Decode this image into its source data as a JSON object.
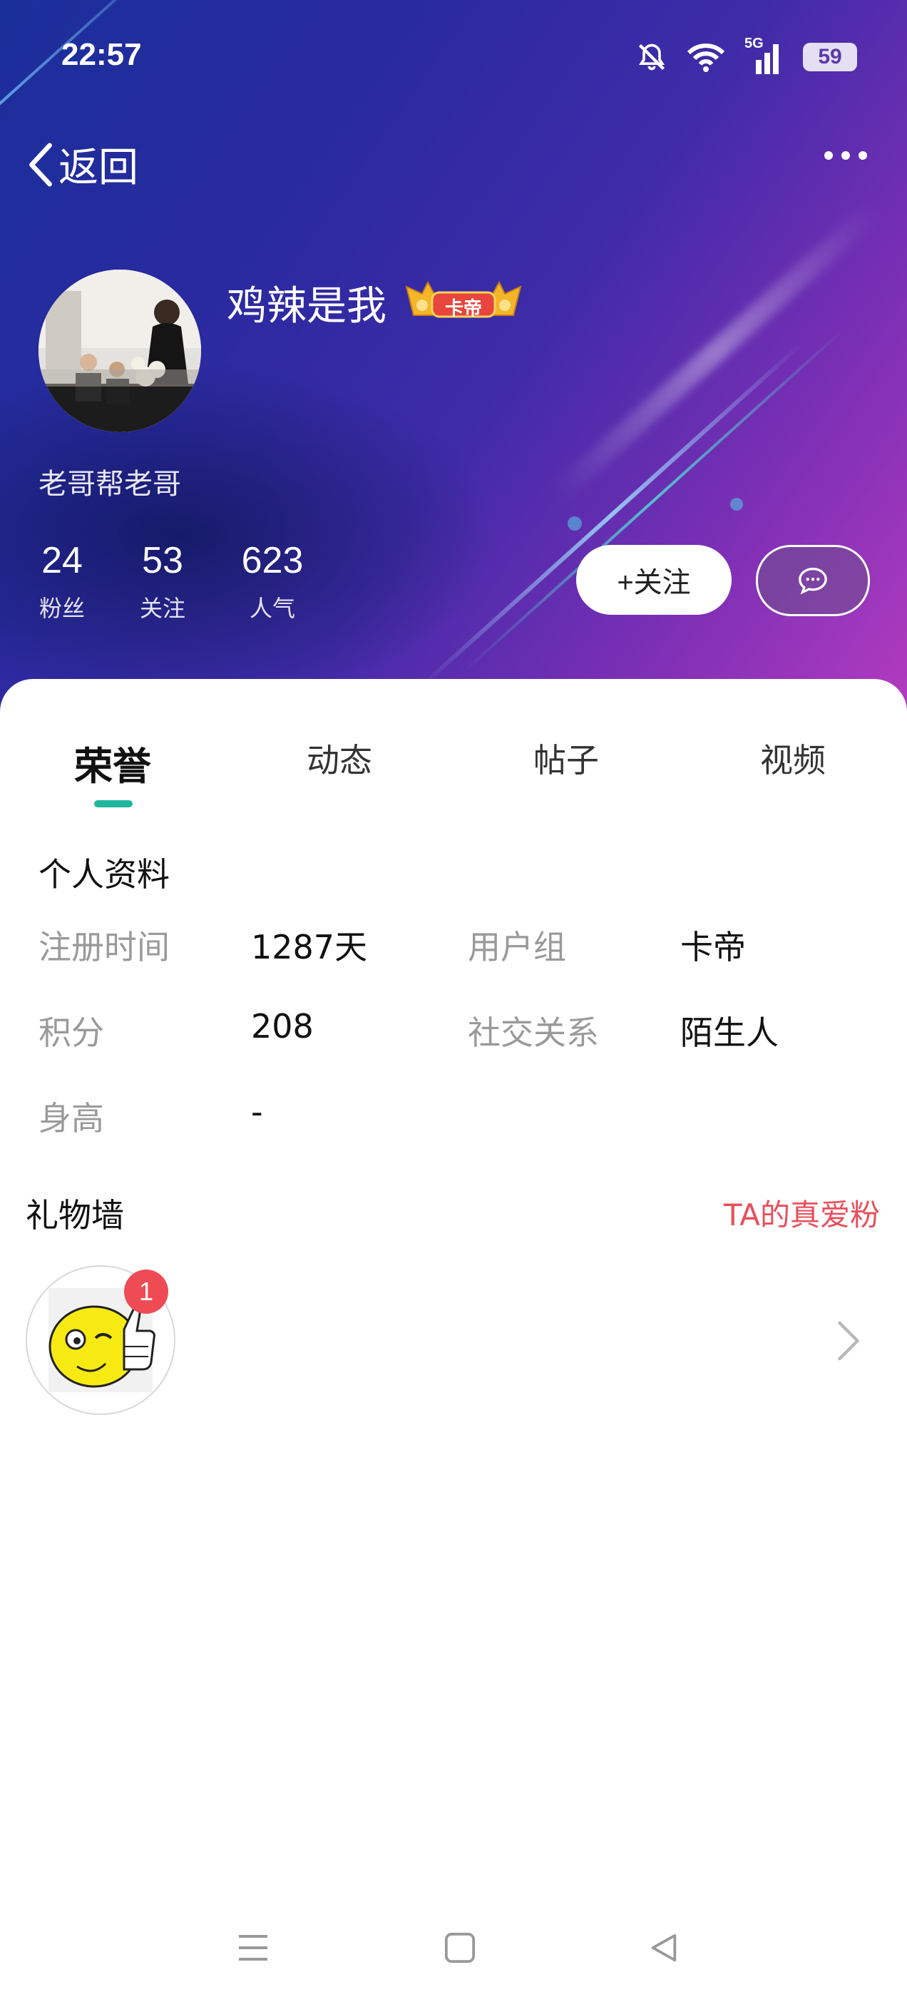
{
  "status_bar": {
    "time": "22:57",
    "network": "5G",
    "battery": "59"
  },
  "nav": {
    "back_label": "返回"
  },
  "profile": {
    "name": "鸡辣是我",
    "badge_text": "卡帝",
    "motto": "老哥帮老哥",
    "stats": [
      {
        "value": "24",
        "label": "粉丝"
      },
      {
        "value": "53",
        "label": "关注"
      },
      {
        "value": "623",
        "label": "人气"
      }
    ],
    "follow_label": "+关注"
  },
  "tabs": [
    {
      "label": "荣誉",
      "active": true
    },
    {
      "label": "动态",
      "active": false
    },
    {
      "label": "帖子",
      "active": false
    },
    {
      "label": "视频",
      "active": false
    }
  ],
  "personal_info": {
    "title": "个人资料",
    "rows": [
      {
        "label": "注册时间",
        "value": "1287天"
      },
      {
        "label": "用户组",
        "value": "卡帝"
      },
      {
        "label": "积分",
        "value": "208"
      },
      {
        "label": "社交关系",
        "value": "陌生人"
      },
      {
        "label": "身高",
        "value": "-"
      }
    ]
  },
  "gift_wall": {
    "title": "礼物墙",
    "link": "TA的真爱粉",
    "gifts": [
      {
        "icon": "thumbs-up-emoji-icon",
        "count": "1"
      }
    ]
  },
  "colors": {
    "accent": "#1fb79e",
    "link_red": "#e8505b",
    "badge_red": "#ee4b55"
  }
}
